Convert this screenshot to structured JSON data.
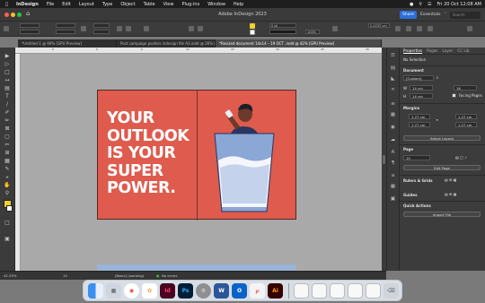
{
  "menubar": {
    "items": [
      "InDesign",
      "File",
      "Edit",
      "Layout",
      "Type",
      "Object",
      "Table",
      "View",
      "Plug-ins",
      "Window",
      "Help"
    ],
    "datetime": "Fri 20 Oct  12:08 AM"
  },
  "app": {
    "title": "Adobe InDesign 2023",
    "share_label": "Share",
    "workspace_label": "Essentials",
    "search_placeholder": "Search"
  },
  "controlbar": {
    "stroke_weight": "0 pt",
    "scale_x": "100%",
    "scale_y": "100%",
    "width_value": "0.4233 cm"
  },
  "tabs": [
    "*Untitled-1 @ 69% [GPU Preview]",
    "Post campaign posters indesign file A3.indd @ 26% [GPU Preview]",
    "*Resized document 14x14 – 19 OCT .indd @ 42% [GPU Preview]"
  ],
  "poster": {
    "headline": [
      "YOUR",
      "OUTLOOK",
      "IS YOUR",
      "SUPER",
      "POWER."
    ],
    "bg_color": "#de5b4e",
    "figure_skin": "#6b3a2a",
    "figure_hair": "#1e1e28",
    "glass_color": "#8aa7d6",
    "water_color": "#ffffff"
  },
  "properties": {
    "tabs": [
      "Properties",
      "Pages",
      "Layer",
      "CC Lib"
    ],
    "no_selection": "No Selection",
    "document_label": "Document",
    "preset": "[Custom]",
    "width": "14 cm",
    "height": "14 cm",
    "pages": "16",
    "facing_pages_label": "Facing Pages",
    "margins_label": "Margins",
    "margin_top": "1.27 cm",
    "margin_bottom": "1.27 cm",
    "margin_left": "1.27 cm",
    "margin_right": "1.27 cm",
    "adjust_layout": "Adjust Layout",
    "page_label": "Page",
    "page_number": "15",
    "edit_page": "Edit Page",
    "rulers_grids": "Rulers & Grids",
    "guides": "Guides",
    "quick_actions": "Quick Actions",
    "import_file": "Import File"
  },
  "statusbar": {
    "zoom": "42.35%",
    "page": "15",
    "style": "[Basic] (working)",
    "errors": "No errors"
  },
  "dock": {
    "apps": [
      "finder",
      "launchpad",
      "chrome",
      "photos",
      "indesign",
      "photoshop",
      "settings",
      "word",
      "outlook",
      "acrobat",
      "illustrator"
    ]
  }
}
